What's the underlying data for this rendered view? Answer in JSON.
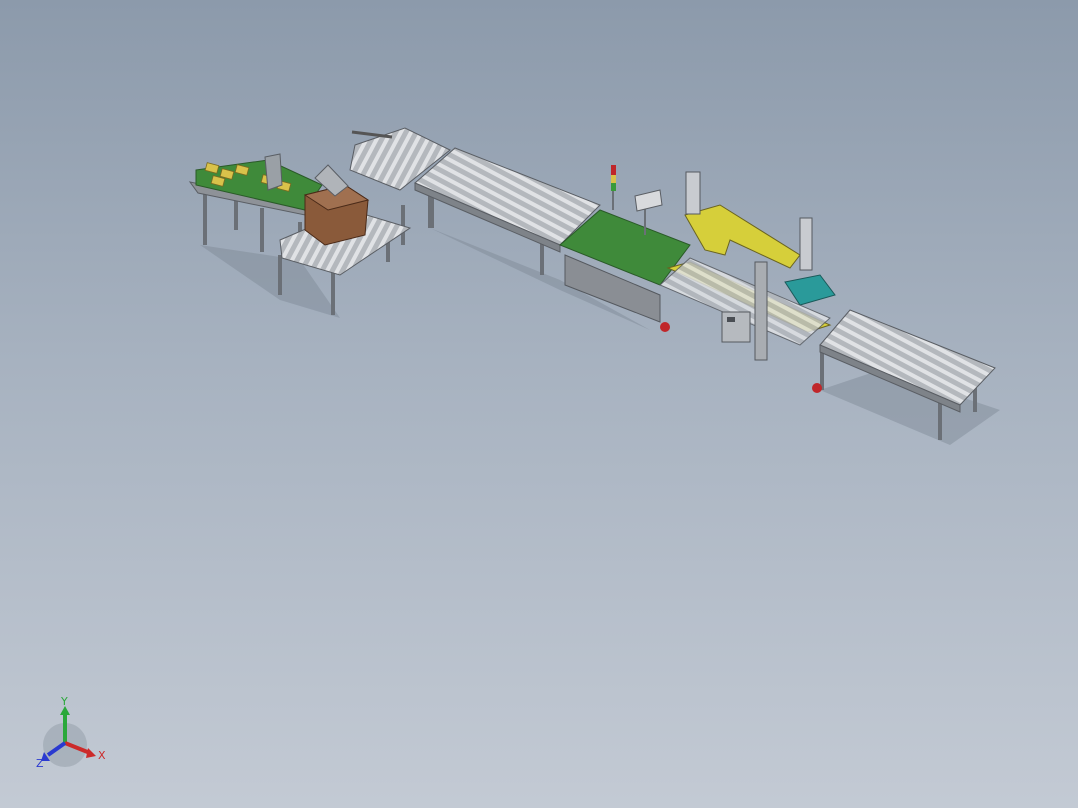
{
  "viewport": {
    "background_top": "#8c9aab",
    "background_bottom": "#c3cad4"
  },
  "model": {
    "colors": {
      "frame": "#9a9ea4",
      "frame_dark": "#5f646b",
      "roller": "#c9ccd0",
      "belt_green": "#3f8a3a",
      "yellow_arm": "#d6cf3a",
      "carton": "#8a5a3a",
      "product_yellow": "#d9c24a",
      "teal": "#2a9a9a",
      "red_caster": "#c0262a"
    },
    "icons": [
      "signal-tower-icon",
      "control-box-icon",
      "weighing-display-icon"
    ]
  },
  "triad": {
    "x_label": "X",
    "y_label": "Y",
    "z_label": "Z",
    "x_color": "#cc2a2a",
    "y_color": "#2aa83a",
    "z_color": "#2a3ad0"
  }
}
